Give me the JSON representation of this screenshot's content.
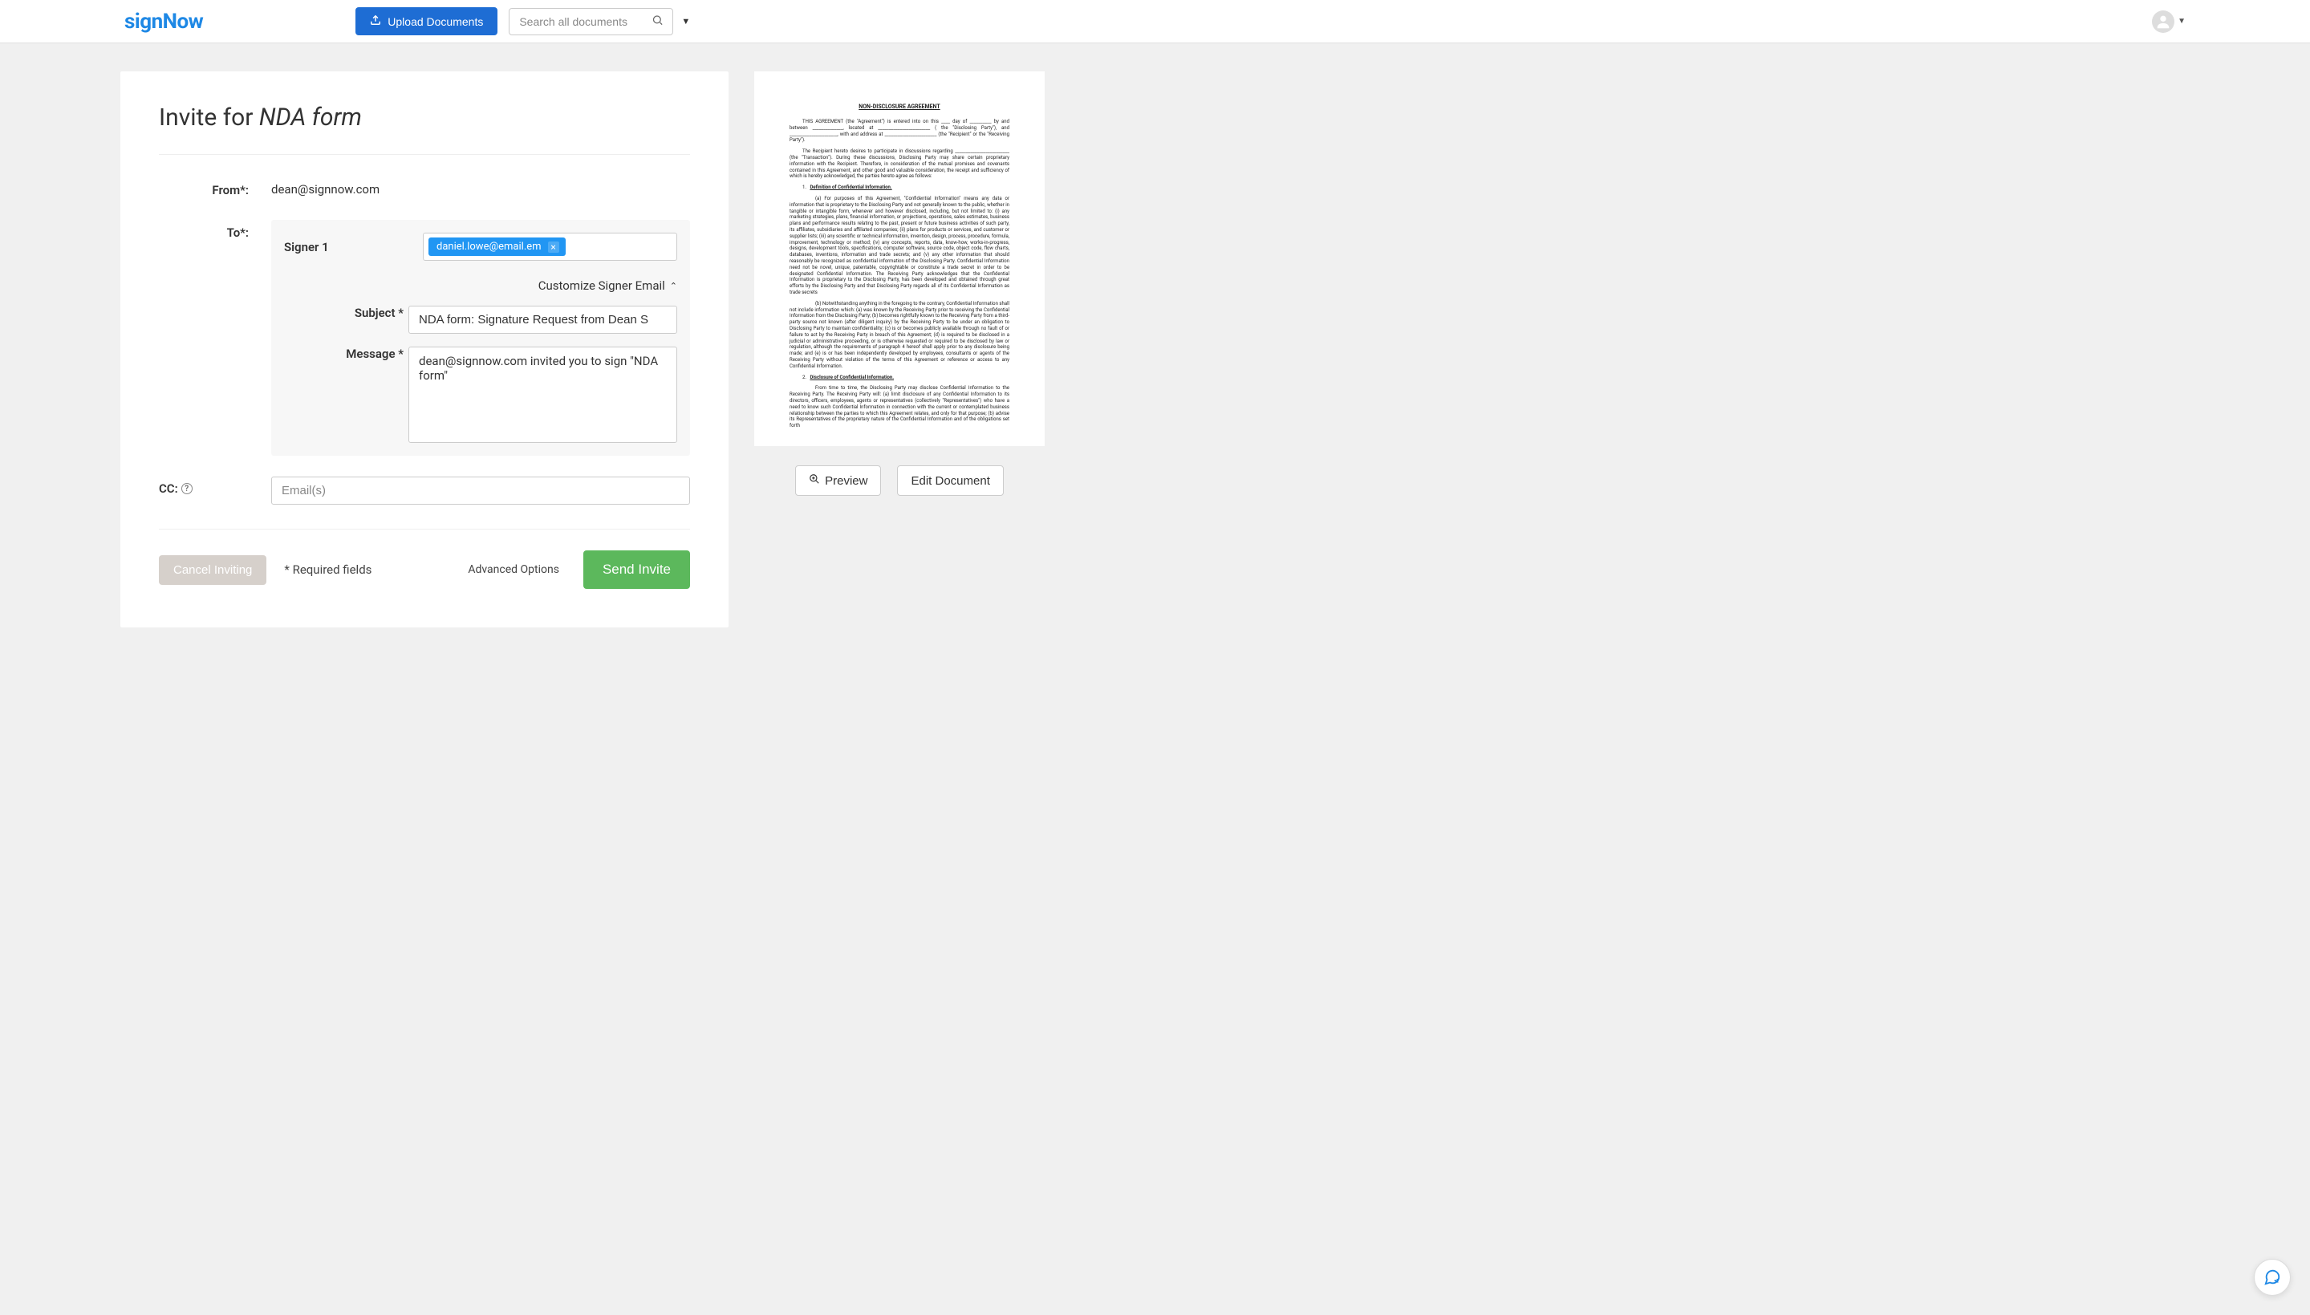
{
  "header": {
    "logo": "signNow",
    "upload_label": "Upload Documents",
    "search_placeholder": "Search all documents"
  },
  "panel": {
    "title_prefix": "Invite for ",
    "title_doc": "NDA form",
    "from_label": "From*:",
    "from_value": "dean@signnow.com",
    "to_label": "To*:",
    "signer_label": "Signer 1",
    "signer_email": "daniel.lowe@email.em",
    "customize_label": "Customize Signer Email",
    "subject_label": "Subject *",
    "subject_value": "NDA form: Signature Request from Dean S",
    "message_label": "Message *",
    "message_value": "dean@signnow.com invited you to sign \"NDA form\"",
    "cc_label": "CC:",
    "cc_placeholder": "Email(s)",
    "cancel_label": "Cancel Inviting",
    "required_note": "* Required fields",
    "advanced_label": "Advanced Options",
    "send_label": "Send Invite"
  },
  "preview": {
    "doc_title": "NON-DISCLOSURE AGREEMENT",
    "intro1": "THIS AGREEMENT (the \"Agreement\") is entered into on this ____ day of __________ by and between ______________, located at ________________________ ( the \"Disclosing Party\"), and ______________________, with and address at ________________________ (the \"Recipient\" or the \"Receiving Party\").",
    "intro2": "The Recipient hereto desires to participate in discussions regarding _________________________ (the \"Transaction\"). During these discussions, Disclosing Party may share certain proprietary information with the Recipient. Therefore, in consideration of the mutual promises and covenants contained in this Agreement, and other good and valuable consideration, the receipt and sufficiency of which is hereby acknowledged, the parties hereto agree as follows:",
    "sec1_num": "1.",
    "sec1_title": "Definition of Confidential Information.",
    "para_a": "(a)       For purposes of this Agreement, \"Confidential Information\" means any data or information that is proprietary to the Disclosing Party and not generally known to the public, whether in tangible or intangible form, whenever and however disclosed, including, but not limited to: (i) any marketing strategies, plans, financial information, or projections, operations, sales estimates, business plans and performance results relating to the past, present or future business activities of such party, its affiliates, subsidiaries and affiliated companies; (ii) plans for products or services, and customer or supplier lists; (iii) any scientific or technical information, invention, design, process, procedure, formula, improvement, technology or method; (iv) any concepts, reports, data, know-how, works-in-progress, designs, development tools, specifications, computer software, source code, object code, flow charts, databases, inventions, information and trade secrets; and (v) any other information that should reasonably be recognized as confidential information of the Disclosing Party. Confidential Information need not be novel, unique, patentable, copyrightable or constitute a trade secret in order to be designated Confidential Information. The Receiving Party acknowledges that the Confidential Information is proprietary to the Disclosing Party, has been developed and obtained through great efforts by the Disclosing Party and that Disclosing Party regards all of its Confidential Information as trade secrets",
    "para_b": "(b)     Notwithstanding anything in the foregoing to the contrary, Confidential Information shall not include information which: (a) was known by the Receiving Party prior to receiving the Confidential Information from the Disclosing Party; (b) becomes rightfully known to the Receiving Party from a third-party source not known (after diligent inquiry) by the Receiving Party to be under an obligation to Disclosing Party to maintain confidentiality; (c) is or becomes publicly available through no fault of or failure to act by the Receiving Party in breach of this Agreement; (d) is required to be disclosed in a judicial or administrative proceeding, or is otherwise requested or required to be disclosed by law or regulation, although the requirements of paragraph 4 hereof shall apply prior to any disclosure being made; and (e) is or has been independently developed by employees, consultants or agents of the Receiving Party without violation of the terms of this Agreement or reference or access to any Confidential Information.",
    "sec2_num": "2.",
    "sec2_title": "Disclosure of Confidential Information.",
    "para_c": "From time to time, the Disclosing Party may disclose Confidential Information to the Receiving Party. The Receiving Party will: (a) limit disclosure of any Confidential Information to its directors, officers, employees, agents or representatives (collectively \"Representatives\") who have a need to know such Confidential Information in connection with the current or contemplated business relationship between the parties to which this Agreement relates, and only for that purpose; (b) advise its Representatives of the proprietary nature of the Confidential Information and of the obligations set forth",
    "preview_btn": "Preview",
    "edit_btn": "Edit Document"
  }
}
